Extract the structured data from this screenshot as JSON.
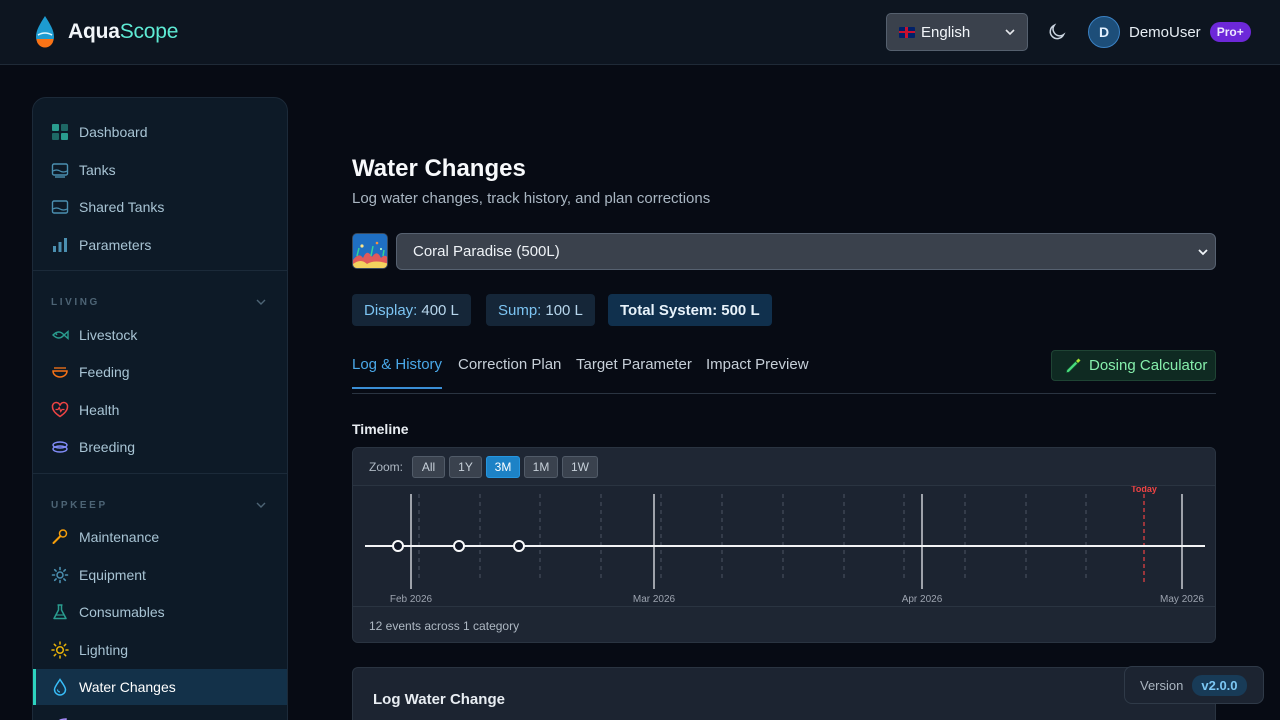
{
  "app": {
    "name_part1": "Aqua",
    "name_part2": "Scope"
  },
  "header": {
    "language": "English",
    "username": "DemoUser",
    "avatar_initial": "D",
    "badge": "Pro+"
  },
  "sidebar": {
    "top_items": [
      {
        "label": "Dashboard",
        "icon": "grid-icon"
      },
      {
        "label": "Tanks",
        "icon": "tank-icon"
      },
      {
        "label": "Shared Tanks",
        "icon": "shared-tank-icon"
      },
      {
        "label": "Parameters",
        "icon": "chart-icon"
      }
    ],
    "living": {
      "title": "LIVING",
      "items": [
        {
          "label": "Livestock",
          "icon": "fish-icon"
        },
        {
          "label": "Feeding",
          "icon": "bowl-icon"
        },
        {
          "label": "Health",
          "icon": "heart-icon"
        },
        {
          "label": "Breeding",
          "icon": "breeding-icon"
        }
      ]
    },
    "upkeep": {
      "title": "UPKEEP",
      "items": [
        {
          "label": "Maintenance",
          "icon": "wrench-icon"
        },
        {
          "label": "Equipment",
          "icon": "gear-icon"
        },
        {
          "label": "Consumables",
          "icon": "flask-icon"
        },
        {
          "label": "Lighting",
          "icon": "sun-icon"
        },
        {
          "label": "Water Changes",
          "icon": "droplet-icon",
          "active": true
        }
      ]
    }
  },
  "main": {
    "title": "Water Changes",
    "subtitle": "Log water changes, track history, and plan corrections",
    "tank_select": "Coral Paradise (500L)",
    "volumes": {
      "display_key": "Display:",
      "display_val": "400 L",
      "sump_key": "Sump:",
      "sump_val": "100 L",
      "total_key": "Total System:",
      "total_val": "500 L"
    },
    "tabs": [
      "Log & History",
      "Correction Plan",
      "Target Parameter",
      "Impact Preview"
    ],
    "dosing_button": "Dosing Calculator",
    "timeline": {
      "label": "Timeline",
      "zoom_label": "Zoom:",
      "zoom_options": [
        "All",
        "1Y",
        "3M",
        "1M",
        "1W"
      ],
      "zoom_active": "3M",
      "month_labels": [
        "Feb 2026",
        "Mar 2026",
        "Apr 2026",
        "May 2026"
      ],
      "today_label": "Today",
      "event_count_visible": 3,
      "summary": "12 events across 1 category"
    },
    "log_card_title": "Log Water Change"
  },
  "version": {
    "label": "Version",
    "value": "v2.0.0"
  },
  "colors": {
    "accent": "#3b8fd6",
    "brand_teal": "#5eead4",
    "success": "#86efac",
    "pro_purple": "#6d28d9",
    "today_marker": "#ef4444"
  }
}
